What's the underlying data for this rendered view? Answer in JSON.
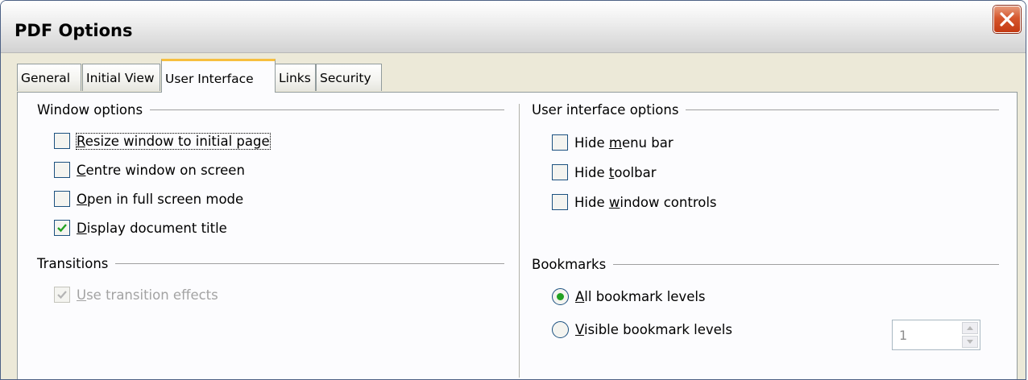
{
  "window": {
    "title": "PDF Options"
  },
  "tabs": [
    {
      "label": "General"
    },
    {
      "label": "Initial View"
    },
    {
      "label": "User Interface",
      "active": true
    },
    {
      "label": "Links"
    },
    {
      "label": "Security"
    }
  ],
  "window_options": {
    "heading": "Window options",
    "items": [
      {
        "pre": "",
        "u": "R",
        "post": "esize window to initial page",
        "checked": false
      },
      {
        "pre": "",
        "u": "C",
        "post": "entre window on screen",
        "checked": false
      },
      {
        "pre": "",
        "u": "O",
        "post": "pen in full screen mode",
        "checked": false
      },
      {
        "pre": "",
        "u": "D",
        "post": "isplay document title",
        "checked": true
      }
    ]
  },
  "transitions": {
    "heading": "Transitions",
    "item": {
      "pre": "",
      "u": "U",
      "post": "se transition effects",
      "checked": true,
      "enabled": false
    }
  },
  "ui_options": {
    "heading": "User interface options",
    "items": [
      {
        "pre": "Hide ",
        "u": "m",
        "post": "enu bar",
        "checked": false
      },
      {
        "pre": "Hide ",
        "u": "t",
        "post": "oolbar",
        "checked": false
      },
      {
        "pre": "Hide ",
        "u": "w",
        "post": "indow controls",
        "checked": false
      }
    ]
  },
  "bookmarks": {
    "heading": "Bookmarks",
    "all": {
      "pre": "",
      "u": "A",
      "post": "ll bookmark levels",
      "selected": true
    },
    "visible": {
      "pre": "",
      "u": "V",
      "post": "isible bookmark levels",
      "selected": false
    },
    "level_value": "1"
  },
  "colors": {
    "check": "#21a121",
    "tab_highlight": "#f7bf3e",
    "close": "#d5562d"
  },
  "icons": {
    "close": "close-x-icon",
    "check": "checkmark-icon",
    "spin_up": "triangle-up-icon",
    "spin_down": "triangle-down-icon"
  }
}
